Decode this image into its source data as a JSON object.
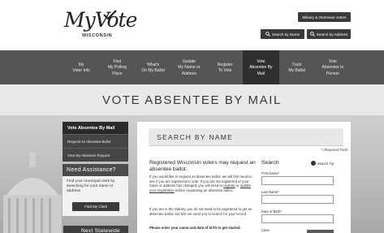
{
  "header": {
    "logo_main": "MyVote",
    "logo_sub": "WISCONSIN",
    "military_button": "Military & Overseas Voters",
    "search_home_button": "Search by Name",
    "search_address_button": "Search by Address"
  },
  "nav": {
    "items": [
      {
        "label": "My\nVoter Info"
      },
      {
        "label": "Find\nMy Polling\nPlace"
      },
      {
        "label": "What's\nOn My Ballot"
      },
      {
        "label": "Update\nMy Name or\nAddress"
      },
      {
        "label": "Register\nTo Vote"
      },
      {
        "label": "Vote\nAbsentee By\nMail"
      },
      {
        "label": "Track\nMy Ballot"
      },
      {
        "label": "Vote\nAbsentee In\nPerson"
      }
    ],
    "active_index": 5
  },
  "page": {
    "title": "VOTE ABSENTEE BY MAIL"
  },
  "sidebar": {
    "heading": "Vote Absentee By Mail",
    "links": [
      "Request An Absentee Ballot",
      "View My Absentee Request"
    ],
    "assist_heading": "Need Assistance?",
    "assist_text": "Find your municipal clerk by searching for your name or address",
    "find_clerk_button": "Find My Clerk",
    "next_statewide": "Next Statewide"
  },
  "main": {
    "heading": "SEARCH BY NAME",
    "required_note": "*=Required Field",
    "intro_heading": "Registered Wisconsin voters may request an absentee ballot.",
    "para1_a": "If you would like to request an absentee ballot, we will first need to see if you are registered to vote. If you are not registered or your name or address has changed, you will need to ",
    "para1_link1": "register",
    "para1_b": " or ",
    "para1_link2": "update your registration",
    "para1_c": " before requesting an absentee ballot.",
    "para2": "If you are in the military, you do not need to be registered to get an absentee ballot, but first we need you to search for your record.",
    "para3": "Please enter your name and date of birth to get started.",
    "search": {
      "label": "Search",
      "tip": "Search Tip",
      "first_name_label": "First Name*",
      "last_name_label": "Last Name*",
      "dob_label": "Date of Birth*",
      "clear_label": "Clear"
    }
  },
  "colors": {
    "nav_bg": "#555555",
    "nav_active": "#2f2f2f",
    "button_dark": "#3a3a3a"
  }
}
